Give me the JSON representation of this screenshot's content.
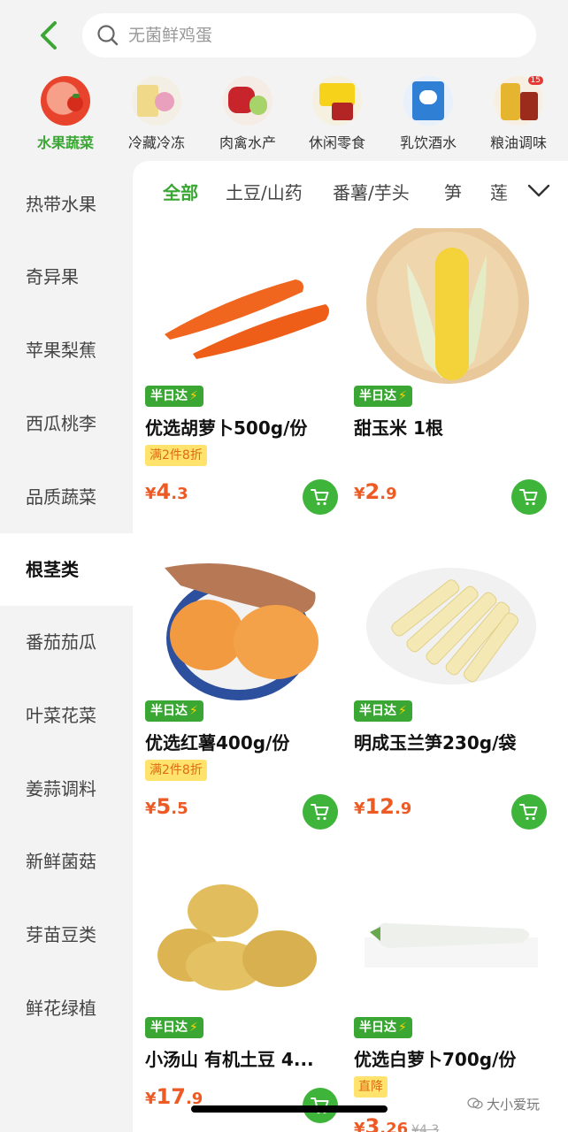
{
  "search": {
    "placeholder": "无菌鲜鸡蛋"
  },
  "categories": [
    {
      "label": "水果蔬菜",
      "icon": "fruit-veg-icon",
      "active": true
    },
    {
      "label": "冷藏冷冻",
      "icon": "frozen-food-icon",
      "active": false
    },
    {
      "label": "肉禽水产",
      "icon": "meat-seafood-icon",
      "active": false
    },
    {
      "label": "休闲零食",
      "icon": "snacks-icon",
      "active": false
    },
    {
      "label": "乳饮酒水",
      "icon": "dairy-drinks-icon",
      "active": false
    },
    {
      "label": "粮油调味",
      "icon": "grain-oil-icon",
      "active": false,
      "badge": "15"
    }
  ],
  "sidebar": {
    "items": [
      {
        "label": "热带水果"
      },
      {
        "label": "奇异果"
      },
      {
        "label": "苹果梨蕉"
      },
      {
        "label": "西瓜桃李"
      },
      {
        "label": "品质蔬菜"
      },
      {
        "label": "根茎类",
        "active": true
      },
      {
        "label": "番茄茄瓜"
      },
      {
        "label": "叶菜花菜"
      },
      {
        "label": "姜蒜调料"
      },
      {
        "label": "新鲜菌菇"
      },
      {
        "label": "芽苗豆类"
      },
      {
        "label": "鲜花绿植"
      }
    ]
  },
  "subtabs": [
    {
      "label": "全部",
      "active": true
    },
    {
      "label": "土豆/山药"
    },
    {
      "label": "番薯/芋头"
    },
    {
      "label": "笋"
    },
    {
      "label": "莲"
    }
  ],
  "products": [
    {
      "tag": "半日达",
      "name": "优选胡萝卜500g/份",
      "promo": "满2件8折",
      "currency": "¥",
      "price_int": "4",
      "price_dec": ".3",
      "old_price": ""
    },
    {
      "tag": "半日达",
      "name": "甜玉米 1根",
      "promo": "",
      "currency": "¥",
      "price_int": "2",
      "price_dec": ".9",
      "old_price": ""
    },
    {
      "tag": "半日达",
      "name": "优选红薯400g/份",
      "promo": "满2件8折",
      "currency": "¥",
      "price_int": "5",
      "price_dec": ".5",
      "old_price": ""
    },
    {
      "tag": "半日达",
      "name": "明成玉兰笋230g/袋",
      "promo": "",
      "currency": "¥",
      "price_int": "12",
      "price_dec": ".9",
      "old_price": ""
    },
    {
      "tag": "半日达",
      "name": "小汤山 有机土豆 4...",
      "promo": "",
      "currency": "¥",
      "price_int": "17",
      "price_dec": ".9",
      "old_price": ""
    },
    {
      "tag": "半日达",
      "name": "优选白萝卜700g/份",
      "promo": "直降",
      "currency": "¥",
      "price_int": "3",
      "price_dec": ".26",
      "old_price": "¥4.3"
    }
  ],
  "watermark": "大小爱玩",
  "colors": {
    "accent": "#3aa633",
    "price": "#ee5a24",
    "promo_bg": "#ffe36d"
  }
}
